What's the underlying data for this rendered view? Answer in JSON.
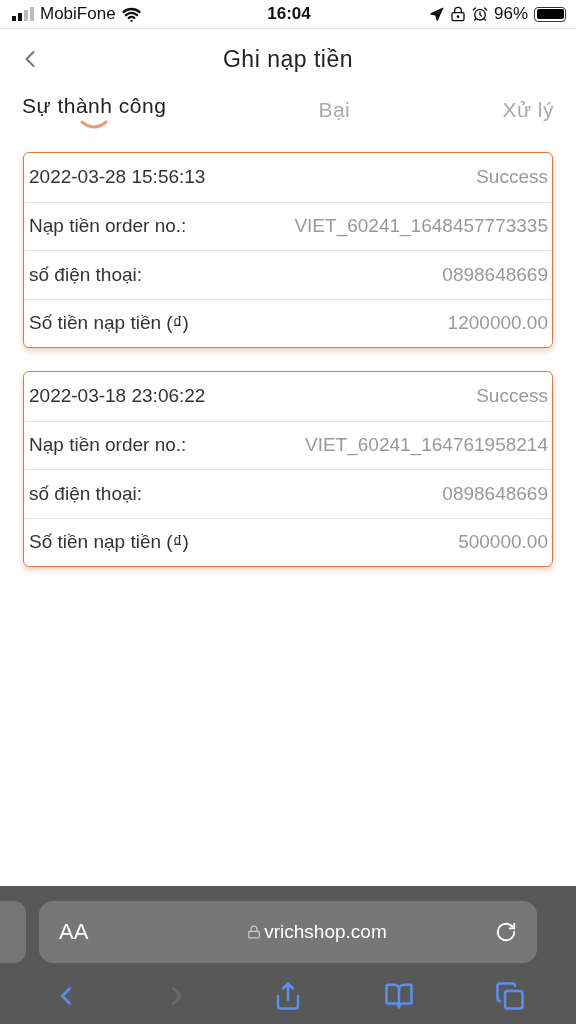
{
  "status_bar": {
    "carrier": "MobiFone",
    "time": "16:04",
    "battery": "96%"
  },
  "header": {
    "title": "Ghi nạp tiền"
  },
  "tabs": [
    {
      "label": "Sự thành công",
      "selected": true
    },
    {
      "label": "Bại",
      "selected": false
    },
    {
      "label": "Xử lý",
      "selected": false
    }
  ],
  "records": [
    {
      "rows": [
        {
          "label": "2022-03-28 15:56:13",
          "value": "Success"
        },
        {
          "label": "Nạp tiền order no.:",
          "value": "VIET_60241_1648457773335"
        },
        {
          "label": "số điện thoại:",
          "value": "0898648669"
        },
        {
          "label": "Số tiền nạp tiền (₫)",
          "value": "1200000.00"
        }
      ]
    },
    {
      "rows": [
        {
          "label": "2022-03-18 23:06:22",
          "value": "Success"
        },
        {
          "label": "Nạp tiền order no.:",
          "value": "VIET_60241_164761958214"
        },
        {
          "label": "số điện thoại:",
          "value": "0898648669"
        },
        {
          "label": "Số tiền nạp tiền (₫)",
          "value": "500000.00"
        }
      ]
    }
  ],
  "browser": {
    "text_size": "AA",
    "url": "vrichshop.com"
  }
}
